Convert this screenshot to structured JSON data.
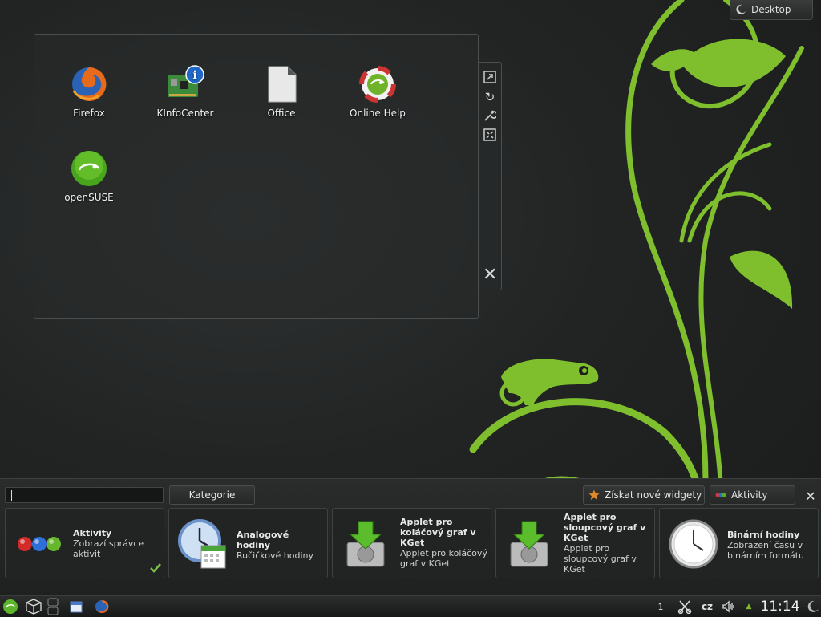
{
  "toolbox": {
    "label": "Desktop"
  },
  "folder_view": {
    "icons": [
      {
        "label": "Firefox",
        "icon": "firefox-icon"
      },
      {
        "label": "KInfoCenter",
        "icon": "kinfocenter-icon"
      },
      {
        "label": "Office",
        "icon": "office-document-icon"
      },
      {
        "label": "Online Help",
        "icon": "online-help-icon"
      },
      {
        "label": "openSUSE",
        "icon": "opensuse-icon"
      }
    ],
    "handle_tools": [
      "resize-icon",
      "rotate-icon",
      "settings-wrench-icon",
      "maximize-icon",
      "close-icon"
    ]
  },
  "explorer": {
    "search_value": "",
    "categories_label": "Kategorie",
    "get_widgets_label": "Získat nové widgety",
    "activities_label": "Aktivity",
    "widgets": [
      {
        "title": "Aktivity",
        "desc": "Zobrazí správce aktivit",
        "icon": "activities-icon",
        "active": true
      },
      {
        "title": "Analogové hodiny",
        "desc": "Ručičkové hodiny",
        "icon": "analog-clock-icon"
      },
      {
        "title": "Applet pro koláčový graf v KGet",
        "desc": "Applet pro koláčový graf v KGet",
        "icon": "kget-download-icon"
      },
      {
        "title": "Applet pro sloupcový graf v KGet",
        "desc": "Applet pro sloupcový graf v KGet",
        "icon": "kget-download-icon"
      },
      {
        "title": "Binární hodiny",
        "desc": "Zobrazení času v binárním formátu",
        "icon": "binary-clock-icon"
      }
    ]
  },
  "panel": {
    "desktop_number": "1",
    "keyboard_layout": "cz",
    "clock": "11:14"
  },
  "colors": {
    "accent_green": "#73ba25",
    "background": "#222424"
  }
}
